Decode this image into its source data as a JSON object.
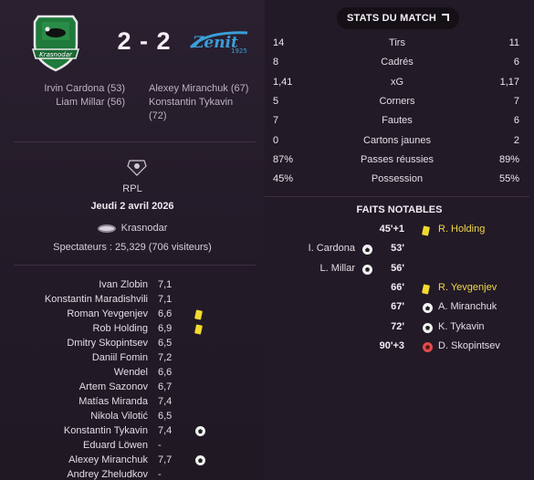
{
  "match": {
    "score": "2 - 2",
    "home_crest_text": "Krasnodar",
    "away_crest_text": "Zenit",
    "away_crest_year": "1925",
    "home_scorers": [
      "Irvin Cardona (53)",
      "Liam Millar (56)"
    ],
    "away_scorers": [
      "Alexey Miranchuk (67)",
      "Konstantin Tykavin",
      "(72)"
    ]
  },
  "info": {
    "league": "RPL",
    "date": "Jeudi 2 avril 2026",
    "venue": "Krasnodar",
    "attendance": "Spectateurs : 25,329 (706 visiteurs)"
  },
  "players": [
    {
      "name": "Ivan Zlobin",
      "rating": "7,1",
      "event": ""
    },
    {
      "name": "Konstantin Maradishvili",
      "rating": "7,1",
      "event": ""
    },
    {
      "name": "Roman Yevgenjev",
      "rating": "6,6",
      "event": "yellow-card"
    },
    {
      "name": "Rob Holding",
      "rating": "6,9",
      "event": "yellow-card"
    },
    {
      "name": "Dmitry Skopintsev",
      "rating": "6,5",
      "event": ""
    },
    {
      "name": "Daniil Fomin",
      "rating": "7,2",
      "event": ""
    },
    {
      "name": "Wendel",
      "rating": "6,6",
      "event": ""
    },
    {
      "name": "Artem Sazonov",
      "rating": "6,7",
      "event": ""
    },
    {
      "name": "Matías Miranda",
      "rating": "7,4",
      "event": ""
    },
    {
      "name": "Nikola Vilotić",
      "rating": "6,5",
      "event": ""
    },
    {
      "name": "Konstantin Tykavin",
      "rating": "7,4",
      "event": "goal"
    },
    {
      "name": "Eduard Löwen",
      "rating": "-",
      "event": ""
    },
    {
      "name": "Alexey Miranchuk",
      "rating": "7,7",
      "event": "goal"
    },
    {
      "name": "Andrey Zheludkov",
      "rating": "-",
      "event": ""
    }
  ],
  "stats": {
    "button_label": "STATS DU MATCH",
    "rows": [
      {
        "home": "14",
        "label": "Tirs",
        "away": "11"
      },
      {
        "home": "8",
        "label": "Cadrés",
        "away": "6"
      },
      {
        "home": "1,41",
        "label": "xG",
        "away": "1,17"
      },
      {
        "home": "5",
        "label": "Corners",
        "away": "7"
      },
      {
        "home": "7",
        "label": "Fautes",
        "away": "6"
      },
      {
        "home": "0",
        "label": "Cartons jaunes",
        "away": "2"
      },
      {
        "home": "87%",
        "label": "Passes réussies",
        "away": "89%"
      },
      {
        "home": "45%",
        "label": "Possession",
        "away": "55%"
      }
    ]
  },
  "events": {
    "title": "FAITS NOTABLES",
    "rows": [
      {
        "home": "",
        "home_icon": "",
        "minute": "45'+1",
        "away_icon": "yellow-card",
        "away": "R. Holding",
        "highlight": true
      },
      {
        "home": "I. Cardona",
        "home_icon": "goal",
        "minute": "53'",
        "away_icon": "",
        "away": "",
        "highlight": false
      },
      {
        "home": "L. Millar",
        "home_icon": "goal",
        "minute": "56'",
        "away_icon": "",
        "away": "",
        "highlight": false
      },
      {
        "home": "",
        "home_icon": "",
        "minute": "66'",
        "away_icon": "yellow-card",
        "away": "R. Yevgenjev",
        "highlight": true
      },
      {
        "home": "",
        "home_icon": "",
        "minute": "67'",
        "away_icon": "goal",
        "away": "A. Miranchuk",
        "highlight": false
      },
      {
        "home": "",
        "home_icon": "",
        "minute": "72'",
        "away_icon": "goal",
        "away": "K. Tykavin",
        "highlight": false
      },
      {
        "home": "",
        "home_icon": "",
        "minute": "90'+3",
        "away_icon": "own-goal",
        "away": "D. Skopintsev",
        "highlight": false
      }
    ]
  },
  "colors": {
    "background": "#231c26",
    "krasnodar_green": "#1f7a3c",
    "zenit_blue": "#3a9fd8",
    "yellow_card": "#f2da2f",
    "highlight_text": "#f0d64a",
    "own_goal": "#e24b4b"
  }
}
